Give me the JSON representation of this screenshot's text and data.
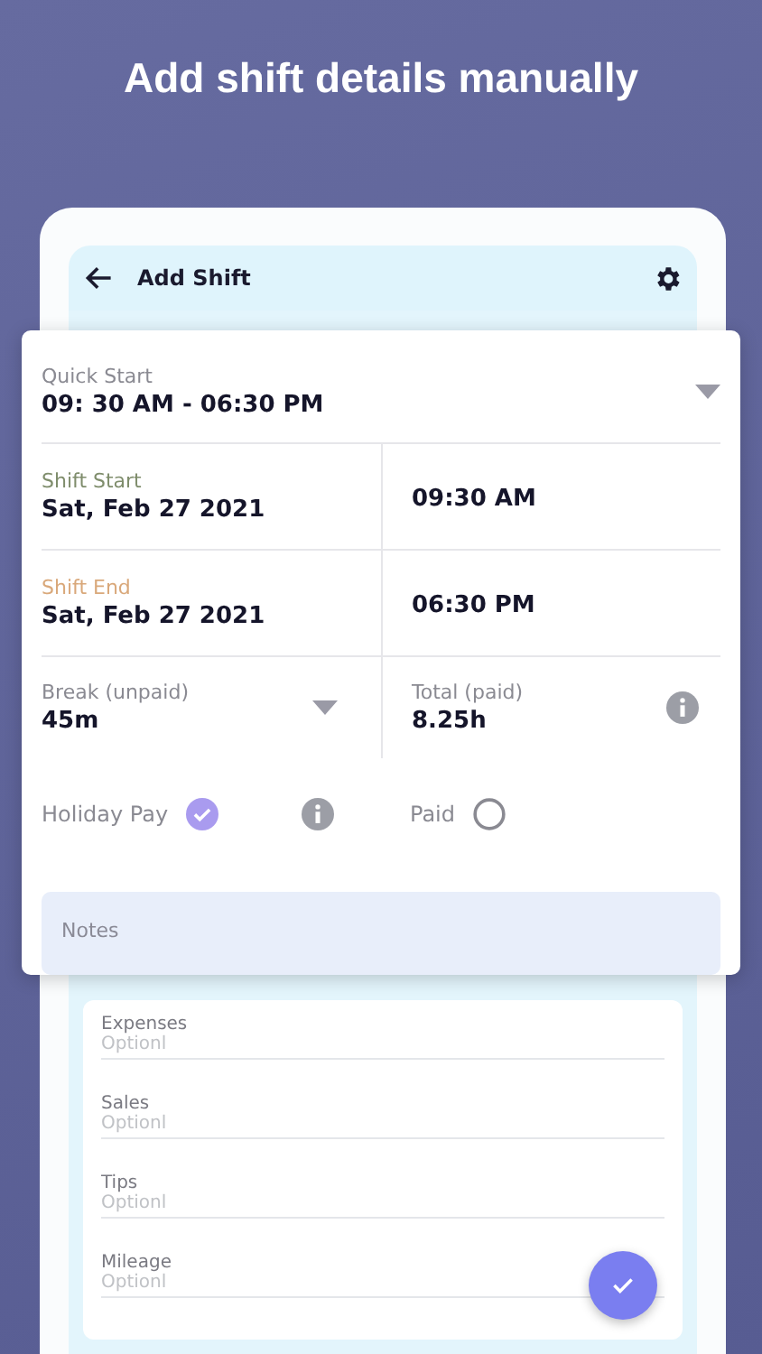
{
  "headline": "Add shift details manually",
  "app_bar": {
    "title": "Add Shift"
  },
  "quick_start": {
    "label": "Quick Start",
    "value": "09: 30 AM - 06:30 PM"
  },
  "shift_start": {
    "label": "Shift Start",
    "date": "Sat, Feb 27 2021",
    "time": "09:30 AM"
  },
  "shift_end": {
    "label": "Shift End",
    "date": "Sat, Feb 27 2021",
    "time": "06:30 PM"
  },
  "break": {
    "label": "Break (unpaid)",
    "value": "45m"
  },
  "total": {
    "label": "Total (paid)",
    "value": "8.25h"
  },
  "holiday_pay": {
    "label": "Holiday Pay",
    "checked": true
  },
  "paid": {
    "label": "Paid",
    "checked": false
  },
  "notes": {
    "placeholder": "Notes"
  },
  "extra_fields": [
    {
      "label": "Expenses",
      "placeholder": "Optionl"
    },
    {
      "label": "Sales",
      "placeholder": "Optionl"
    },
    {
      "label": "Tips",
      "placeholder": "Optionl"
    },
    {
      "label": "Mileage",
      "placeholder": "Optionl"
    }
  ]
}
